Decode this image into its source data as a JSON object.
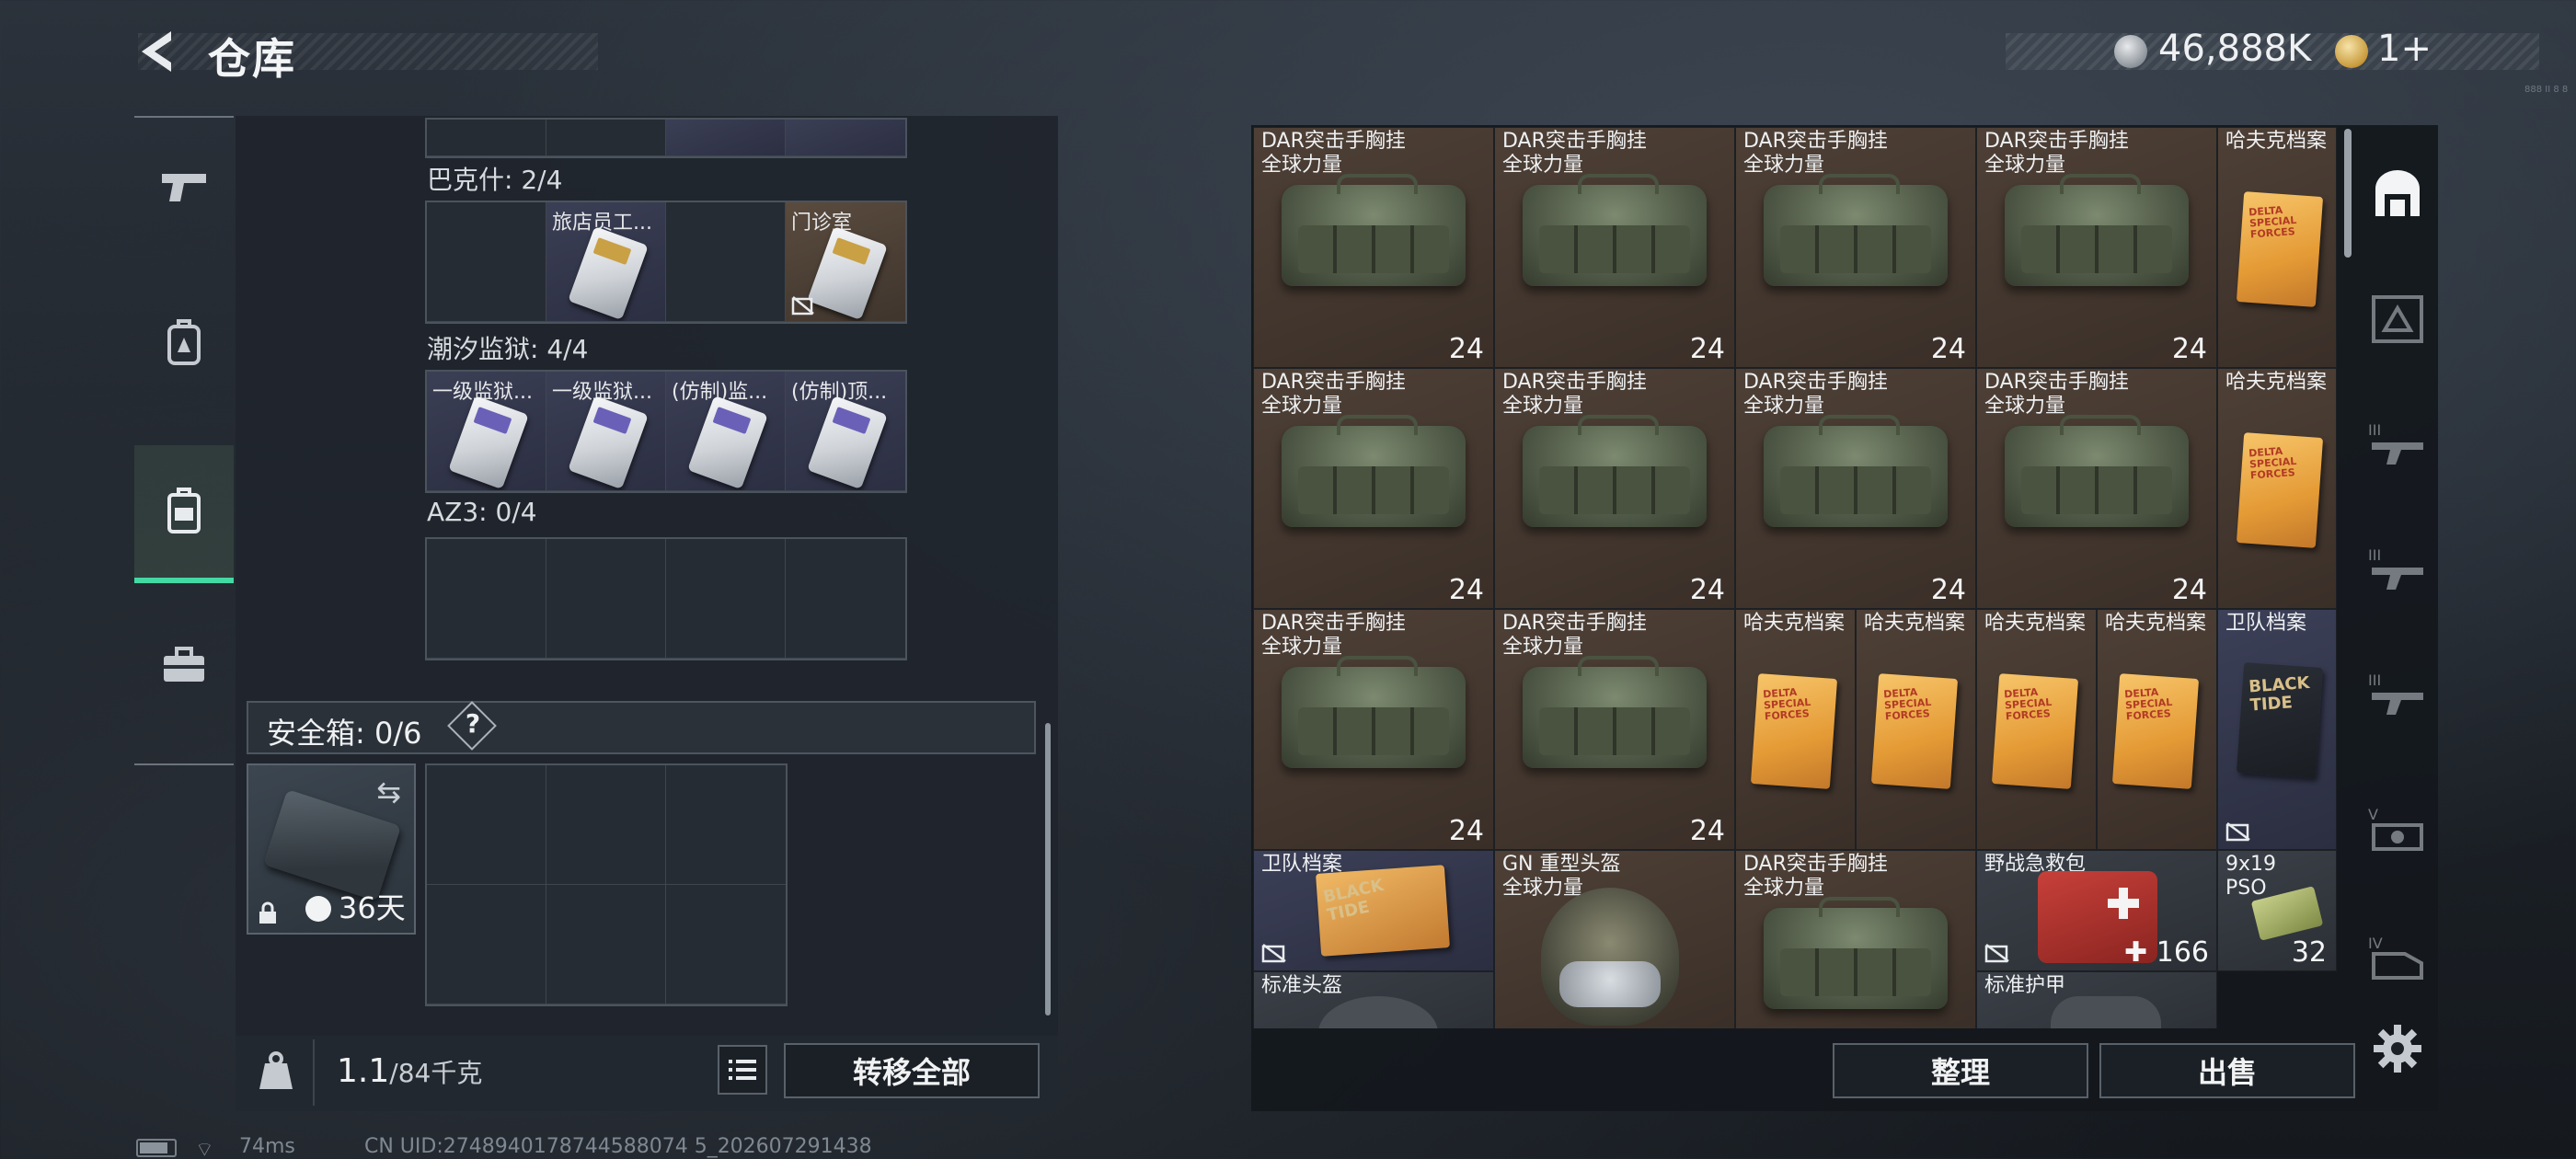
{
  "header": {
    "title": "仓库",
    "coins": "46,888K",
    "tickets": "1+",
    "version_mark": "888 II 8 8"
  },
  "left_nav": {
    "items": [
      "weapons",
      "backpack",
      "case",
      "toolbox"
    ],
    "active": "case"
  },
  "left_panel": {
    "sections": [
      {
        "label": "巴克什: 2/4",
        "slots": [
          {
            "name": ""
          },
          {
            "name": "旅店员工..."
          },
          {
            "name": ""
          },
          {
            "name": "门诊室"
          }
        ]
      },
      {
        "label": "潮汐监狱: 4/4",
        "slots": [
          {
            "name": "一级监狱..."
          },
          {
            "name": "一级监狱..."
          },
          {
            "name": "(仿制)监..."
          },
          {
            "name": "(仿制)顶..."
          }
        ]
      },
      {
        "label": "AZ3: 0/4",
        "slots": [
          {
            "name": ""
          },
          {
            "name": ""
          },
          {
            "name": ""
          },
          {
            "name": ""
          }
        ]
      }
    ],
    "safe_box": {
      "label": "安全箱: 0/6",
      "help": "?",
      "timer": "36天"
    },
    "weight": {
      "value": "1.1",
      "capacity": "/84千克"
    },
    "transfer_all": "转移全部"
  },
  "warehouse": {
    "items": [
      {
        "name": "DAR突击手胸挂\n全球力量",
        "count": "24",
        "col": 0,
        "row": 0,
        "kind": "bag"
      },
      {
        "name": "DAR突击手胸挂\n全球力量",
        "count": "24",
        "col": 1,
        "row": 0,
        "kind": "bag"
      },
      {
        "name": "DAR突击手胸挂\n全球力量",
        "count": "24",
        "col": 2,
        "row": 0,
        "kind": "bag"
      },
      {
        "name": "DAR突击手胸挂\n全球力量",
        "count": "24",
        "col": 3,
        "row": 0,
        "kind": "bag"
      },
      {
        "name": "哈夫克档案",
        "count": "",
        "col": 4,
        "row": 0,
        "kind": "folder"
      },
      {
        "name": "DAR突击手胸挂\n全球力量",
        "count": "24",
        "col": 0,
        "row": 1,
        "kind": "bag"
      },
      {
        "name": "DAR突击手胸挂\n全球力量",
        "count": "24",
        "col": 1,
        "row": 1,
        "kind": "bag"
      },
      {
        "name": "DAR突击手胸挂\n全球力量",
        "count": "24",
        "col": 2,
        "row": 1,
        "kind": "bag"
      },
      {
        "name": "DAR突击手胸挂\n全球力量",
        "count": "24",
        "col": 3,
        "row": 1,
        "kind": "bag"
      },
      {
        "name": "哈夫克档案",
        "count": "",
        "col": 4,
        "row": 1,
        "kind": "folder"
      },
      {
        "name": "DAR突击手胸挂\n全球力量",
        "count": "24",
        "col": 0,
        "row": 2,
        "kind": "bag"
      },
      {
        "name": "DAR突击手胸挂\n全球力量",
        "count": "24",
        "col": 1,
        "row": 2,
        "kind": "bag"
      },
      {
        "name": "哈夫克档案",
        "count": "",
        "col": 2,
        "row": 2,
        "kind": "folder-half-a"
      },
      {
        "name": "哈夫克档案",
        "count": "",
        "col": 2,
        "row": 2,
        "kind": "folder-half-b"
      },
      {
        "name": "哈夫克档案",
        "count": "",
        "col": 3,
        "row": 2,
        "kind": "folder-half-a"
      },
      {
        "name": "哈夫克档案",
        "count": "",
        "col": 3,
        "row": 2,
        "kind": "folder-half-b"
      },
      {
        "name": "卫队档案",
        "count": "",
        "col": 4,
        "row": 2,
        "kind": "black-folder"
      },
      {
        "name": "卫队档案",
        "count": "",
        "col": 0,
        "row": 3,
        "kind": "black-folder-wide"
      },
      {
        "name": "GN 重型头盔\n全球力量",
        "count": "",
        "col": 1,
        "row": 3,
        "kind": "helmet"
      },
      {
        "name": "DAR突击手胸挂\n全球力量",
        "count": "",
        "col": 2,
        "row": 3,
        "kind": "bag"
      },
      {
        "name": "野战急救包",
        "count": "166",
        "col": 3,
        "row": 3,
        "kind": "medkit"
      },
      {
        "name": "9x19\nPSO",
        "count": "32",
        "col": 4,
        "row": 3,
        "kind": "ammo"
      },
      {
        "name": "标准头盔",
        "count": "",
        "col": 0,
        "row": 4,
        "kind": "partial"
      },
      {
        "name": "标准护甲",
        "count": "",
        "col": 3,
        "row": 4,
        "kind": "partial"
      }
    ],
    "sort": "整理",
    "sell": "出售"
  },
  "right_tabs": [
    "all",
    "weapons",
    "grade-III-1",
    "grade-III-2",
    "grade-III-3",
    "grade-V",
    "grade-IV"
  ],
  "status": {
    "ping": "74ms",
    "uid": "CN UID:2748940178744588074 5_202607291438"
  }
}
